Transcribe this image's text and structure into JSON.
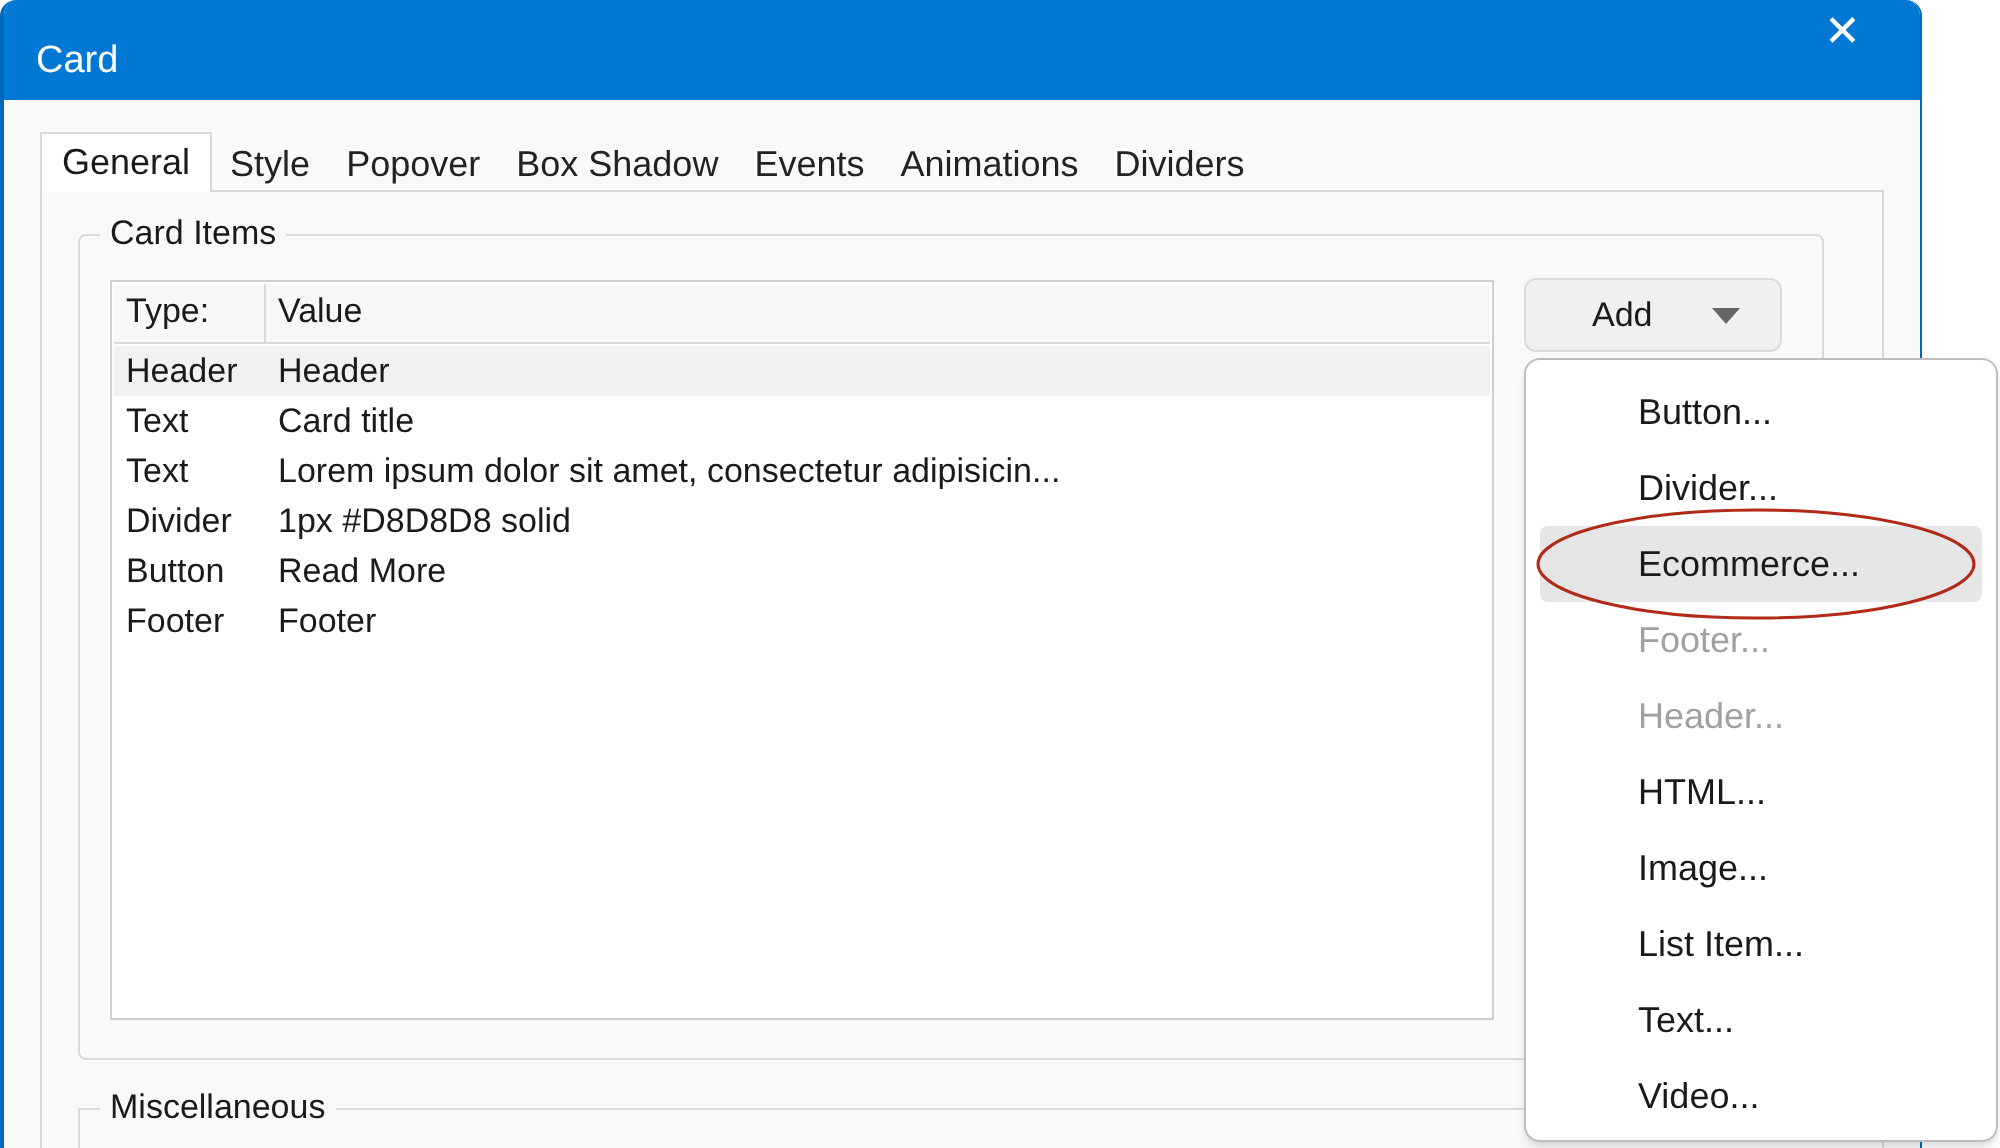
{
  "window": {
    "title": "Card",
    "close": "✕"
  },
  "tabs": [
    {
      "label": "General",
      "selected": true
    },
    {
      "label": "Style",
      "selected": false
    },
    {
      "label": "Popover",
      "selected": false
    },
    {
      "label": "Box Shadow",
      "selected": false
    },
    {
      "label": "Events",
      "selected": false
    },
    {
      "label": "Animations",
      "selected": false
    },
    {
      "label": "Dividers",
      "selected": false
    }
  ],
  "card_items": {
    "title": "Card Items",
    "columns": [
      "Type:",
      "Value"
    ],
    "rows": [
      {
        "type": "Header",
        "value": "Header",
        "selected": true
      },
      {
        "type": "Text",
        "value": "Card title",
        "selected": false
      },
      {
        "type": "Text",
        "value": "Lorem ipsum dolor sit amet, consectetur adipisicin...",
        "selected": false
      },
      {
        "type": "Divider",
        "value": "1px #D8D8D8 solid",
        "selected": false
      },
      {
        "type": "Button",
        "value": "Read More",
        "selected": false
      },
      {
        "type": "Footer",
        "value": "Footer",
        "selected": false
      }
    ],
    "add_button": "Add"
  },
  "add_menu": [
    {
      "label": "Button...",
      "disabled": false,
      "selected": false
    },
    {
      "label": "Divider...",
      "disabled": false,
      "selected": false
    },
    {
      "label": "Ecommerce...",
      "disabled": false,
      "selected": true,
      "circled": true
    },
    {
      "label": "Footer...",
      "disabled": true,
      "selected": false
    },
    {
      "label": "Header...",
      "disabled": true,
      "selected": false
    },
    {
      "label": "HTML...",
      "disabled": false,
      "selected": false
    },
    {
      "label": "Image...",
      "disabled": false,
      "selected": false
    },
    {
      "label": "List Item...",
      "disabled": false,
      "selected": false
    },
    {
      "label": "Text...",
      "disabled": false,
      "selected": false
    },
    {
      "label": "Video...",
      "disabled": false,
      "selected": false
    }
  ],
  "miscellaneous": {
    "title": "Miscellaneous"
  }
}
